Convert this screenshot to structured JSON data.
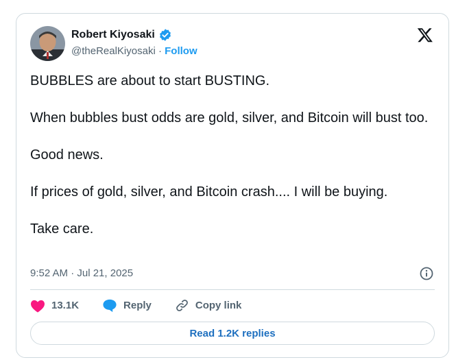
{
  "author": {
    "name": "Robert Kiyosaki",
    "handle": "@theRealKiyosaki",
    "separator": " · ",
    "follow_label": "Follow",
    "verified": true
  },
  "tweet": {
    "paragraphs": [
      "BUBBLES are about to start BUSTING.",
      "When bubbles bust odds are gold, silver, and Bitcoin will bust too.",
      "Good news.",
      "If prices of gold, silver, and Bitcoin crash.... I will be buying.",
      "Take care."
    ],
    "timestamp": "9:52 AM · Jul 21, 2025"
  },
  "actions": {
    "like_count": "13.1K",
    "reply_label": "Reply",
    "copy_link_label": "Copy link"
  },
  "footer": {
    "read_replies_label": "Read 1.2K replies"
  },
  "colors": {
    "accent": "#1d9bf0",
    "like": "#f91880",
    "text": "#0f1419",
    "muted": "#536471",
    "border": "#cfd9de"
  },
  "icons": {
    "platform": "x-logo-icon",
    "verified": "verified-badge-icon",
    "info": "info-icon",
    "like": "heart-icon",
    "reply": "speech-bubble-icon",
    "copy": "link-icon"
  }
}
